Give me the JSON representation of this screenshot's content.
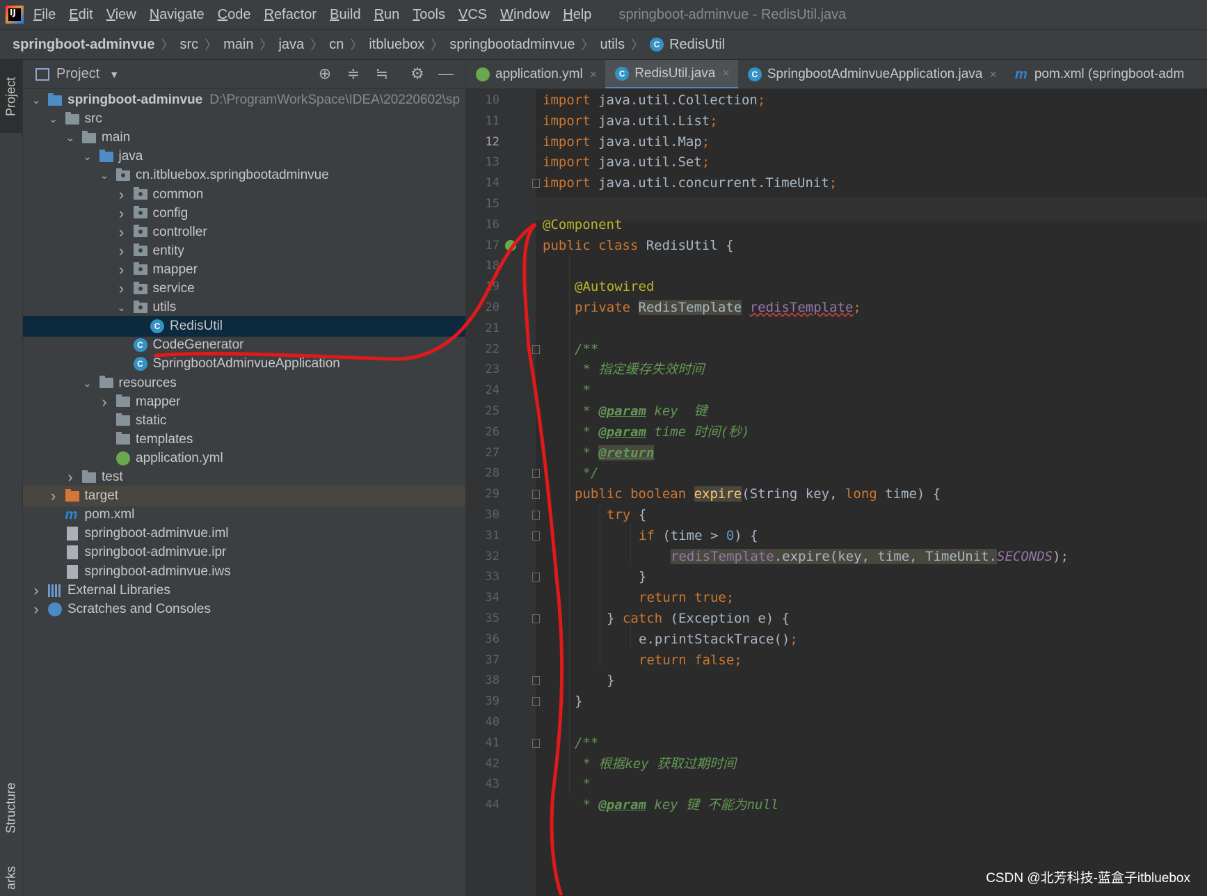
{
  "menubar": {
    "items": [
      "File",
      "Edit",
      "View",
      "Navigate",
      "Code",
      "Refactor",
      "Build",
      "Run",
      "Tools",
      "VCS",
      "Window",
      "Help"
    ],
    "window_title": "springboot-adminvue - RedisUtil.java"
  },
  "breadcrumb": [
    "springboot-adminvue",
    "src",
    "main",
    "java",
    "cn",
    "itbluebox",
    "springbootadminvue",
    "utils",
    "RedisUtil"
  ],
  "side_tabs": {
    "project": "Project",
    "structure": "Structure",
    "bookmarks": "arks"
  },
  "project_panel": {
    "title": "Project",
    "tree": [
      {
        "label": "springboot-adminvue",
        "path": "D:\\ProgramWorkSpace\\IDEA\\20220602\\sp"
      },
      {
        "label": "src"
      },
      {
        "label": "main"
      },
      {
        "label": "java"
      },
      {
        "label": "cn.itbluebox.springbootadminvue"
      },
      {
        "label": "common"
      },
      {
        "label": "config"
      },
      {
        "label": "controller"
      },
      {
        "label": "entity"
      },
      {
        "label": "mapper"
      },
      {
        "label": "service"
      },
      {
        "label": "utils"
      },
      {
        "label": "RedisUtil"
      },
      {
        "label": "CodeGenerator"
      },
      {
        "label": "SpringbootAdminvueApplication"
      },
      {
        "label": "resources"
      },
      {
        "label": "mapper"
      },
      {
        "label": "static"
      },
      {
        "label": "templates"
      },
      {
        "label": "application.yml"
      },
      {
        "label": "test"
      },
      {
        "label": "target"
      },
      {
        "label": "pom.xml"
      },
      {
        "label": "springboot-adminvue.iml"
      },
      {
        "label": "springboot-adminvue.ipr"
      },
      {
        "label": "springboot-adminvue.iws"
      },
      {
        "label": "External Libraries"
      },
      {
        "label": "Scratches and Consoles"
      }
    ]
  },
  "editor_tabs": [
    {
      "label": "application.yml"
    },
    {
      "label": "RedisUtil.java"
    },
    {
      "label": "SpringbootAdminvueApplication.java"
    },
    {
      "label": "pom.xml (springboot-adm"
    }
  ],
  "line_numbers": [
    "10",
    "11",
    "12",
    "13",
    "14",
    "15",
    "16",
    "17",
    "18",
    "19",
    "20",
    "21",
    "22",
    "23",
    "24",
    "25",
    "26",
    "27",
    "28",
    "29",
    "30",
    "31",
    "32",
    "33",
    "34",
    "35",
    "36",
    "37",
    "38",
    "39",
    "40",
    "41",
    "42",
    "43",
    "44"
  ],
  "code": {
    "l10": {
      "kw": "import",
      "rest": " java.util.Collection",
      "semi": ";"
    },
    "l11": {
      "kw": "import",
      "rest": " java.util.List",
      "semi": ";"
    },
    "l12": {
      "kw": "import",
      "rest": " java.util.Map",
      "semi": ";"
    },
    "l13": {
      "kw": "import",
      "rest": " java.util.Set",
      "semi": ";"
    },
    "l14": {
      "kw": "import",
      "rest": " java.util.concurrent.TimeUnit",
      "semi": ";"
    },
    "l16": {
      "ann": "@Component"
    },
    "l17": {
      "kw": "public class",
      "name": " RedisUtil {"
    },
    "l19": {
      "ann": "@Autowired"
    },
    "l20": {
      "kw": "private",
      "type": "RedisTemplate",
      "field": "redisTemplate",
      "semi": ";"
    },
    "l22": {
      "cm": "/**"
    },
    "l23": {
      "cm": " * 指定缓存失效时间"
    },
    "l24": {
      "cm": " *"
    },
    "l25": {
      "star": " * ",
      "tag": "@param",
      "rest": " key  键"
    },
    "l26": {
      "star": " * ",
      "tag": "@param",
      "rest": " time 时间(秒)"
    },
    "l27": {
      "star": " * ",
      "tag": "@return"
    },
    "l28": {
      "cm": " */"
    },
    "l29": {
      "kw": "public boolean",
      "fn": "expire",
      "p1": "(String key, ",
      "kw2": "long",
      "p2": " time) {"
    },
    "l30": {
      "kw": "try",
      "rest": " {"
    },
    "l31": {
      "kw": "if",
      "rest": " (time > ",
      "num": "0",
      "rest2": ") {"
    },
    "l32": {
      "field": "redisTemplate",
      "call": ".expire(key, time, TimeUnit.",
      "cst": "SECONDS",
      "end": ");"
    },
    "l33": {
      "rest": "}"
    },
    "l34": {
      "kw": "return true",
      "semi": ";"
    },
    "l35": {
      "rest": "} ",
      "kw": "catch",
      "rest2": " (Exception e) {"
    },
    "l36": {
      "rest": "e.printStackTrace()",
      "semi": ";"
    },
    "l37": {
      "kw": "return false",
      "semi": ";"
    },
    "l38": {
      "rest": "}"
    },
    "l39": {
      "rest": "}"
    },
    "l41": {
      "cm": "/**"
    },
    "l42": {
      "cm": " * 根据key 获取过期时间"
    },
    "l43": {
      "cm": " *"
    },
    "l44": {
      "star": " * ",
      "tag": "@param",
      "rest": " key 键 不能为null"
    }
  },
  "watermark": "CSDN @北芳科技-蓝盒子itbluebox",
  "colors": {
    "annotation_stroke": "#e0191b",
    "selection": "#0d293e",
    "keyword": "#cc7832"
  }
}
